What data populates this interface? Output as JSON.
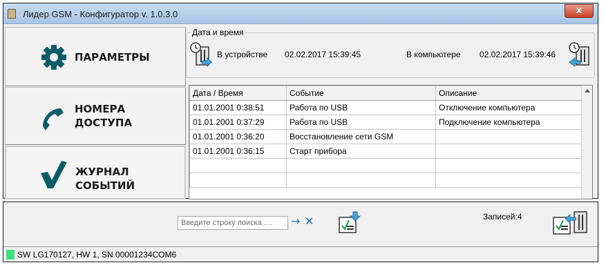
{
  "window": {
    "title": "Лидер GSM - Конфигуратор   v. 1.0.3.0",
    "close_label": "x"
  },
  "nav": {
    "params_label": "ПАРАМЕТРЫ",
    "numbers_label_1": "НОМЕРА",
    "numbers_label_2": "ДОСТУПА",
    "journal_label_1": "ЖУРНАЛ",
    "journal_label_2": "СОБЫТИЙ"
  },
  "datetime": {
    "group_label": "Дата и время",
    "device_label": "В устройстве",
    "device_value": "02.02.2017 15:39:45",
    "computer_label": "В компьютере",
    "computer_value": "02.02.2017 15:39:46"
  },
  "events": {
    "columns": [
      "Дата / Время",
      "Событие",
      "Описание"
    ],
    "rows": [
      [
        "01.01.2001 0:38:51",
        "Работа по USB",
        "Отключение компьютера"
      ],
      [
        "01.01.2001 0:37:29",
        "Работа по USB",
        "Подключение компьютера"
      ],
      [
        "01.01.2001 0:36:20",
        "Восстановление сети GSM",
        ""
      ],
      [
        "01.01.2001 0:36:15",
        "Старт прибора",
        ""
      ],
      [
        "",
        "",
        ""
      ],
      [
        "",
        "",
        ""
      ]
    ]
  },
  "search": {
    "placeholder": "Введите строку поиска  ....",
    "go_icon": "→",
    "clear_icon": "✕"
  },
  "records_label": "Записей:4",
  "status": {
    "text": "SW LG170127, HW 1, SN 00001234COM6",
    "led_color": "#39e07a"
  },
  "colors": {
    "accent": "#1b6fb8",
    "icon_dark": "#0b5b69"
  }
}
